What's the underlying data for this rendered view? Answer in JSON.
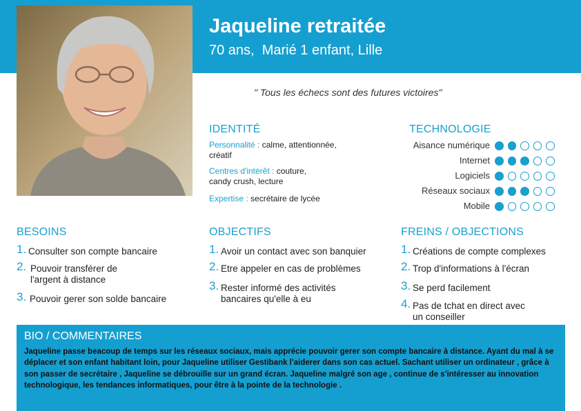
{
  "profile": {
    "name": "Jaqueline retraitée",
    "subtitle": "70 ans,  Marié 1 enfant, Lille",
    "quote": "\" Tous les échecs sont des futures victoires\""
  },
  "identity": {
    "title": "IDENTITÉ",
    "rows": [
      {
        "label": "Personnalité :",
        "value": "calme, attentionnée, créatif"
      },
      {
        "label": "Centres d'intérêt :",
        "value": "couture, candy crush, lecture"
      },
      {
        "label": "Expertise :",
        "value": "secrétaire de lycée"
      }
    ]
  },
  "technology": {
    "title": "TECHNOLOGIE",
    "max_level": 5,
    "rows": [
      {
        "label": "Aisance numérique",
        "level": 2
      },
      {
        "label": "Internet",
        "level": 3
      },
      {
        "label": "Logiciels",
        "level": 1
      },
      {
        "label": "Réseaux sociaux",
        "level": 3
      },
      {
        "label": "Mobile",
        "level": 1
      }
    ]
  },
  "needs": {
    "title": "BESOINS",
    "items": [
      {
        "num": "1.",
        "text": "Consulter son compte bancaire"
      },
      {
        "num": "2.",
        "text": "Pouvoir transférer de l'argent à distance"
      },
      {
        "num": "3.",
        "text": "Pouvoir gerer son solde bancaire"
      }
    ]
  },
  "goals": {
    "title": "OBJECTIFS",
    "items": [
      {
        "num": "1.",
        "text": "Avoir un contact avec son banquier"
      },
      {
        "num": "2.",
        "text": "Etre appeler en cas de problèmes"
      },
      {
        "num": "3.",
        "text": "Rester informé des activités bancaires qu'elle à eu"
      }
    ]
  },
  "obstacles": {
    "title": "FREINS / OBJECTIONS",
    "items": [
      {
        "num": "1.",
        "text": "Créations de compte complexes"
      },
      {
        "num": "2.",
        "text": "Trop d'informations à l'écran"
      },
      {
        "num": "3.",
        "text": "Se perd facilement"
      },
      {
        "num": "4.",
        "text": "Pas de tchat en direct avec un conseiller"
      }
    ]
  },
  "bio": {
    "title": "BIO / COMMENTAIRES",
    "text": "Jaqueline passe beacoup de temps sur les réseaux sociaux, mais apprécie pouvoir gerer son compte bancaire à distance. Ayant du mal à se déplacer et son enfant habitant loin, pour Jaqueline utiliser Gestibank l'aiderer dans son cas actuel. Sachant utiliser un ordinateur , grâce à son passer de secrétaire , Jaqueline se débrouille sur un grand écran. Jaqueline malgré son age , continue de s'intéresser au innovation technologique, les tendances informatiques, pour être à la pointe de la technologie ."
  },
  "colors": {
    "accent": "#159fd0",
    "text": "#222222"
  }
}
